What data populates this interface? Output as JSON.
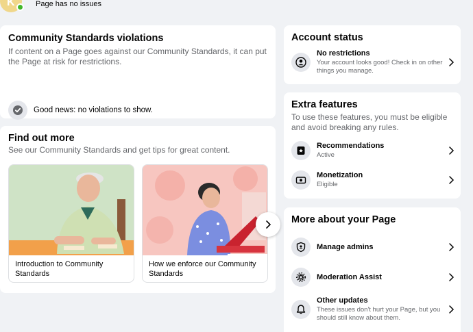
{
  "header": {
    "avatar_letter": "K",
    "status": "Page has no issues"
  },
  "violations": {
    "title": "Community Standards violations",
    "description": "If content on a Page goes against our Community Standards, it can put the Page at risk for restrictions.",
    "good_news": "Good news: no violations to show."
  },
  "find_out_more": {
    "title": "Find out more",
    "description": "See our Community Standards and get tips for great content.",
    "articles": [
      {
        "caption": "Introduction to Community Standards"
      },
      {
        "caption": "How we enforce our Community Standards"
      }
    ]
  },
  "account_status": {
    "title": "Account status",
    "item": {
      "label": "No restrictions",
      "meta": "Your account looks good! Check in on other things you manage.",
      "icon": "person-icon"
    }
  },
  "extra_features": {
    "title": "Extra features",
    "description": "To use these features, you must be eligible and avoid breaking any rules.",
    "items": [
      {
        "label": "Recommendations",
        "meta": "Active",
        "icon": "recommendation-icon"
      },
      {
        "label": "Monetization",
        "meta": "Eligible",
        "icon": "money-icon"
      }
    ]
  },
  "more_about": {
    "title": "More about your Page",
    "items": [
      {
        "label": "Manage admins",
        "icon": "shield-icon"
      },
      {
        "label": "Moderation Assist",
        "icon": "gear-icon"
      },
      {
        "label": "Other updates",
        "meta": "These issues don't hurt your Page, but you should still know about them.",
        "icon": "bell-icon"
      }
    ]
  },
  "colors": {
    "accent_green": "#42b72a",
    "icon_bg": "#e4e6eb",
    "secondary_text": "#65676b"
  }
}
